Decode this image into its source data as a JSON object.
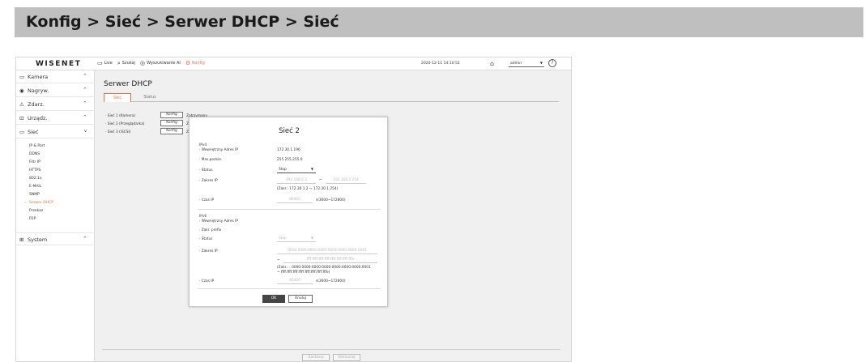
{
  "heading": "Konfig > Sieć > Serwer DHCP > Sieć",
  "topbar": {
    "logo": "WISENET",
    "nav": [
      {
        "icon": "monitor-icon",
        "glyph": "▭",
        "label": "Live"
      },
      {
        "icon": "search-icon",
        "glyph": "⌕",
        "label": "Szukaj"
      },
      {
        "icon": "ai-search-icon",
        "glyph": "◎",
        "label": "Wyszukiwanie AI"
      },
      {
        "icon": "gear-icon",
        "glyph": "⚙",
        "label": "Konfig"
      }
    ],
    "datetime": "2020-12-11 14:10:51",
    "user": "admin",
    "help": "?"
  },
  "sidebar": {
    "items": [
      {
        "icon": "camera-icon",
        "glyph": "▭",
        "label": "Kamera",
        "chevron": "^"
      },
      {
        "icon": "record-icon",
        "glyph": "◉",
        "label": "Nagryw.",
        "chevron": "^"
      },
      {
        "icon": "event-icon",
        "glyph": "⚠",
        "label": "Zdarz.",
        "chevron": "^"
      },
      {
        "icon": "device-icon",
        "glyph": "⊡",
        "label": "Urządz.",
        "chevron": "^"
      },
      {
        "icon": "network-icon",
        "glyph": "▭",
        "label": "Sieć",
        "chevron": "v"
      }
    ],
    "subitems": [
      "IP & Port",
      "DDNS",
      "Filtr IP",
      "HTTPS",
      "802.1x",
      "E-MAIL",
      "SNMP",
      "Serwer DHCP",
      "Przekaz",
      "P2P"
    ],
    "system": {
      "icon": "system-icon",
      "glyph": "⊞",
      "label": "System",
      "chevron": "^"
    }
  },
  "main": {
    "title": "Serwer DHCP",
    "tabs": [
      "Sieć",
      "Status"
    ],
    "networks": [
      {
        "label": "Sieć 1 (Kamera)",
        "button": "Konfig",
        "state": "Zatrzymany"
      },
      {
        "label": "Sieć 2 (Przeglądarka)",
        "button": "Konfig",
        "state": "Z"
      },
      {
        "label": "Sieć 3 (iSCSI)",
        "button": "Konfig",
        "state": "Z"
      }
    ],
    "bottom_buttons": [
      "Zastosuj",
      "Odrzuciaj"
    ]
  },
  "modal": {
    "title": "Sieć 2",
    "ipv4": {
      "section": "IPv4",
      "internal_ip_label": "Wewnętrzny Adres IP",
      "internal_ip": "172.30.1.196",
      "mask_label": "Mas.podsie.",
      "mask": "255.255.255.0",
      "status_label": "Status",
      "status": "Stop",
      "range_label": "Zakres IP",
      "range_from": "192.168.2.2",
      "range_to": "192.168.2.254",
      "range_note": "(Zakr.: 172.30.1.2 ~ 172.30.1.254)",
      "lease_label": "Czas IP",
      "lease": "86400",
      "lease_note": "s(3600~172800)"
    },
    "ipv6": {
      "section": "IPv6",
      "internal_ip_label": "Wewnętrzny Adres IP",
      "prefix_label": "Zakr. prefix",
      "status_label": "Status",
      "status": "Stop",
      "range_label": "Zakres IP",
      "range_from": "0000:0000:0000:0000:0000:0000:0000:0001",
      "range_to": "ffff:ffff:ffff:ffff:ffff:ffff:ffff:fffe",
      "range_note_1": "(Zakr.: : 0000:0000:0000:0000:0000:0000:0000:0001",
      "range_note_2": "~ ffff:ffff:ffff:ffff:ffff:ffff:ffff:fffe)",
      "lease_label": "Czas IP",
      "lease": "86400",
      "lease_note": "s(3600~172800)"
    },
    "ok": "OK",
    "cancel": "Anuluj"
  },
  "colors": {
    "accent": "#e8734a",
    "banner": "#bfbfbf",
    "ok_button": "#444444"
  }
}
